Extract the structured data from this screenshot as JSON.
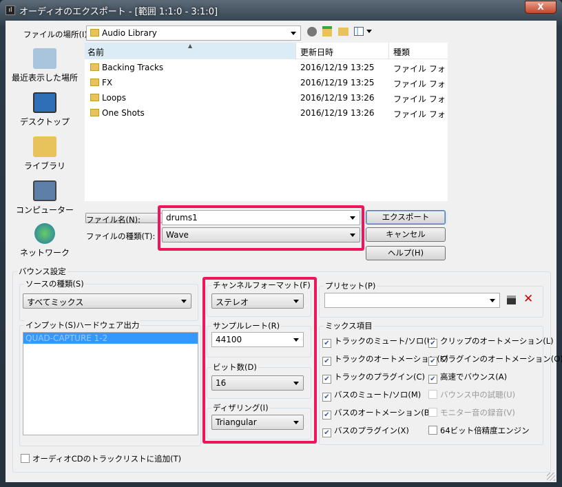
{
  "window": {
    "title": "オーディオのエクスポート - [範囲 1:1:0 - 3:1:0]",
    "close_label": "X"
  },
  "location": {
    "label": "ファイルの場所(I):",
    "value": "Audio Library"
  },
  "toolbar_icons": [
    "back-icon",
    "up-folder-icon",
    "new-folder-icon",
    "view-menu-icon"
  ],
  "places": [
    {
      "label": "最近表示した場所",
      "icon": "recent-places-icon"
    },
    {
      "label": "デスクトップ",
      "icon": "desktop-icon"
    },
    {
      "label": "ライブラリ",
      "icon": "library-icon"
    },
    {
      "label": "コンピューター",
      "icon": "computer-icon"
    },
    {
      "label": "ネットワーク",
      "icon": "network-icon"
    }
  ],
  "file_list": {
    "columns": [
      "名前",
      "更新日時",
      "種類"
    ],
    "rows": [
      {
        "name": "Backing Tracks",
        "date": "2016/12/19 13:25",
        "type": "ファイル フォ"
      },
      {
        "name": "FX",
        "date": "2016/12/19 13:25",
        "type": "ファイル フォ"
      },
      {
        "name": "Loops",
        "date": "2016/12/19 13:26",
        "type": "ファイル フォ"
      },
      {
        "name": "One Shots",
        "date": "2016/12/19 13:26",
        "type": "ファイル フォ"
      }
    ],
    "scroll_grip": "III"
  },
  "filename": {
    "label": "ファイル名(N):",
    "value": "drums1"
  },
  "filetype": {
    "label": "ファイルの種類(T):",
    "value": "Wave"
  },
  "buttons": {
    "export": "エクスポート",
    "cancel": "キャンセル",
    "help": "ヘルプ(H)"
  },
  "bounce": {
    "title": "バウンス設定",
    "source": {
      "label": "ソースの種類(S)",
      "value": "すべてミックス"
    },
    "input": {
      "label": "インプット(S)ハードウェア出力",
      "items": [
        "QUAD-CAPTURE 1-2"
      ]
    },
    "channel": {
      "label": "チャンネルフォーマット(F)",
      "value": "ステレオ"
    },
    "samplerate": {
      "label": "サンプルレート(R)",
      "value": "44100"
    },
    "bits": {
      "label": "ビット数(D)",
      "value": "16"
    },
    "dither": {
      "label": "ディザリング(I)",
      "value": "Triangular"
    },
    "preset": {
      "label": "プリセット(P)",
      "value": ""
    },
    "mix": {
      "label": "ミックス項目",
      "items": [
        {
          "label": "トラックのミュート/ソロ(U)",
          "checked": true,
          "enabled": true
        },
        {
          "label": "クリップのオートメーション(L)",
          "checked": true,
          "enabled": true
        },
        {
          "label": "トラックのオートメーション(K)",
          "checked": true,
          "enabled": true
        },
        {
          "label": "プラグインのオートメーション(O)",
          "checked": true,
          "enabled": true
        },
        {
          "label": "トラックのプラグイン(C)",
          "checked": true,
          "enabled": true
        },
        {
          "label": "高速でバウンス(A)",
          "checked": true,
          "enabled": true
        },
        {
          "label": "バスのミュート/ソロ(M)",
          "checked": true,
          "enabled": true
        },
        {
          "label": "バウンス中の試聴(U)",
          "checked": false,
          "enabled": false
        },
        {
          "label": "バスのオートメーション(B)",
          "checked": true,
          "enabled": true
        },
        {
          "label": "モニター音の録音(V)",
          "checked": false,
          "enabled": false
        },
        {
          "label": "バスのプラグイン(X)",
          "checked": true,
          "enabled": true
        },
        {
          "label": "64ビット倍精度エンジン",
          "checked": false,
          "enabled": true
        }
      ]
    },
    "cd": {
      "label": "オーディオCDのトラックリストに追加(T)",
      "checked": false
    }
  },
  "colors": {
    "highlight": "#f0145a",
    "selection": "#3399ff"
  }
}
